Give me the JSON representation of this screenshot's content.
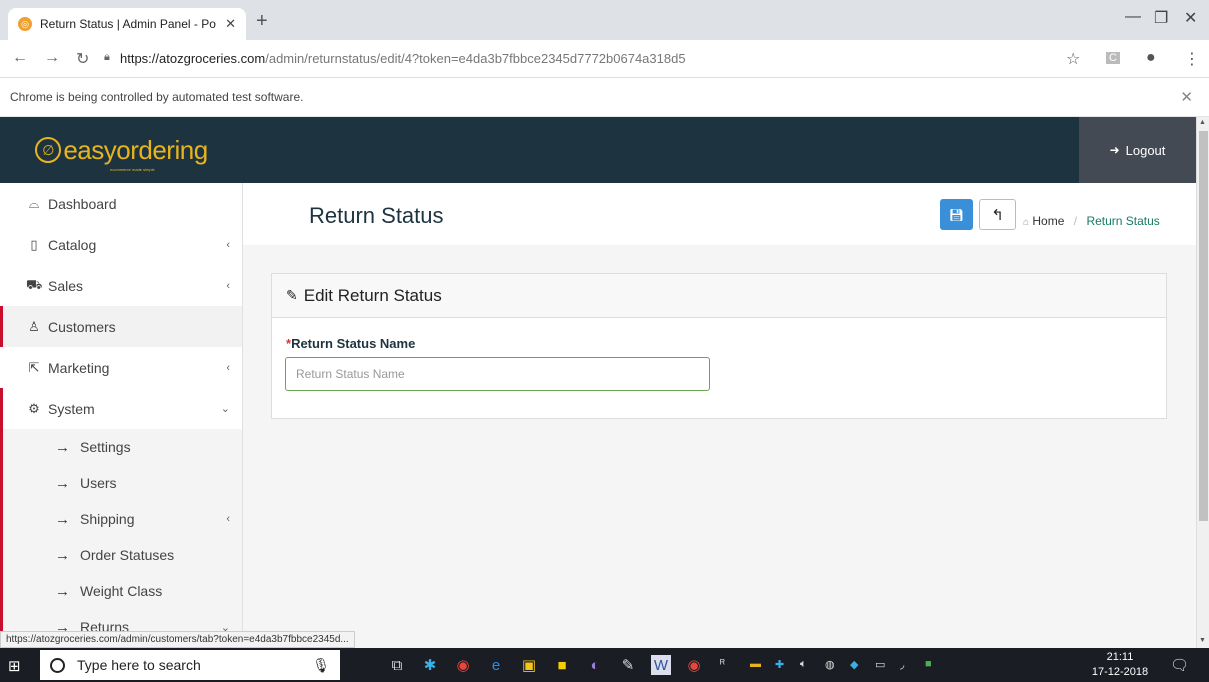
{
  "browser": {
    "tab_title": "Return Status | Admin Panel - Po",
    "url_domain": "https://atozgroceries.com",
    "url_path": "/admin/returnstatus/edit/4?token=e4da3b7fbbce2345d7772b0674a318d5",
    "info_message": "Chrome is being controlled by automated test software.",
    "status_url": "https://atozgroceries.com/admin/customers/tab?token=e4da3b7fbbce2345d..."
  },
  "header": {
    "logo_text": "easyordering",
    "logo_sub": "ecommerce made simple",
    "logout_label": "Logout"
  },
  "sidebar": {
    "items": [
      {
        "label": "Dashboard"
      },
      {
        "label": "Catalog"
      },
      {
        "label": "Sales"
      },
      {
        "label": "Customers"
      },
      {
        "label": "Marketing"
      },
      {
        "label": "System"
      }
    ],
    "system_sub": [
      {
        "label": "Settings"
      },
      {
        "label": "Users"
      },
      {
        "label": "Shipping"
      },
      {
        "label": "Order Statuses"
      },
      {
        "label": "Weight Class"
      },
      {
        "label": "Returns"
      }
    ]
  },
  "page": {
    "title": "Return Status",
    "breadcrumb_home": "Home",
    "breadcrumb_current": "Return Status",
    "panel_title": "Edit Return Status",
    "field_label": "Return Status Name",
    "field_placeholder": "Return Status Name",
    "field_value": ""
  },
  "taskbar": {
    "search_placeholder": "Type here to search",
    "time": "21:11",
    "date": "17-12-2018"
  }
}
